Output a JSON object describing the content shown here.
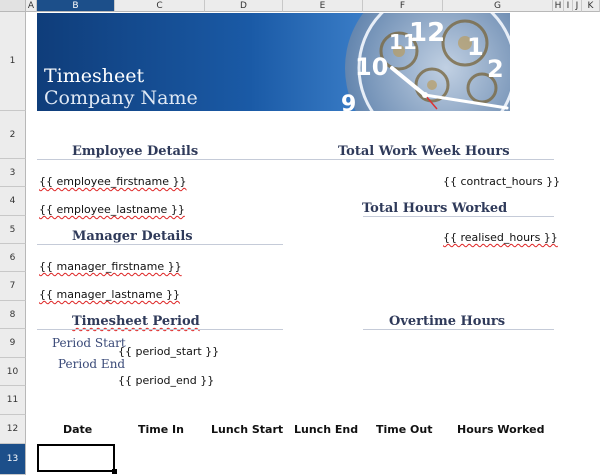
{
  "columns": [
    "A",
    "B",
    "C",
    "D",
    "E",
    "F",
    "G",
    "H",
    "I",
    "J",
    "K"
  ],
  "rows": [
    "1",
    "2",
    "3",
    "4",
    "5",
    "6",
    "7",
    "8",
    "9",
    "10",
    "11",
    "12",
    "13"
  ],
  "selected_cell": "B13",
  "banner": {
    "title": "Timesheet",
    "company": "Company Name"
  },
  "employee": {
    "heading": "Employee Details",
    "firstname": "{{ employee_firstname }}",
    "lastname": "{{ employee_lastname }}"
  },
  "manager": {
    "heading": "Manager Details",
    "firstname": "{{ manager_firstname }}",
    "lastname": "{{ manager_lastname }}"
  },
  "period": {
    "heading": "Timesheet Period",
    "start_label": "Period Start",
    "end_label": "Period End",
    "start": "{{ period_start }}",
    "end": "{{ period_end }}"
  },
  "week": {
    "heading": "Total Work Week Hours",
    "value": "{{ contract_hours }}"
  },
  "worked": {
    "heading": "Total Hours Worked",
    "value": "{{ realised_hours }}"
  },
  "overtime": {
    "heading": "Overtime Hours"
  },
  "table_headers": [
    "Date",
    "Time In",
    "Lunch Start",
    "Lunch End",
    "Time Out",
    "Hours Worked"
  ]
}
